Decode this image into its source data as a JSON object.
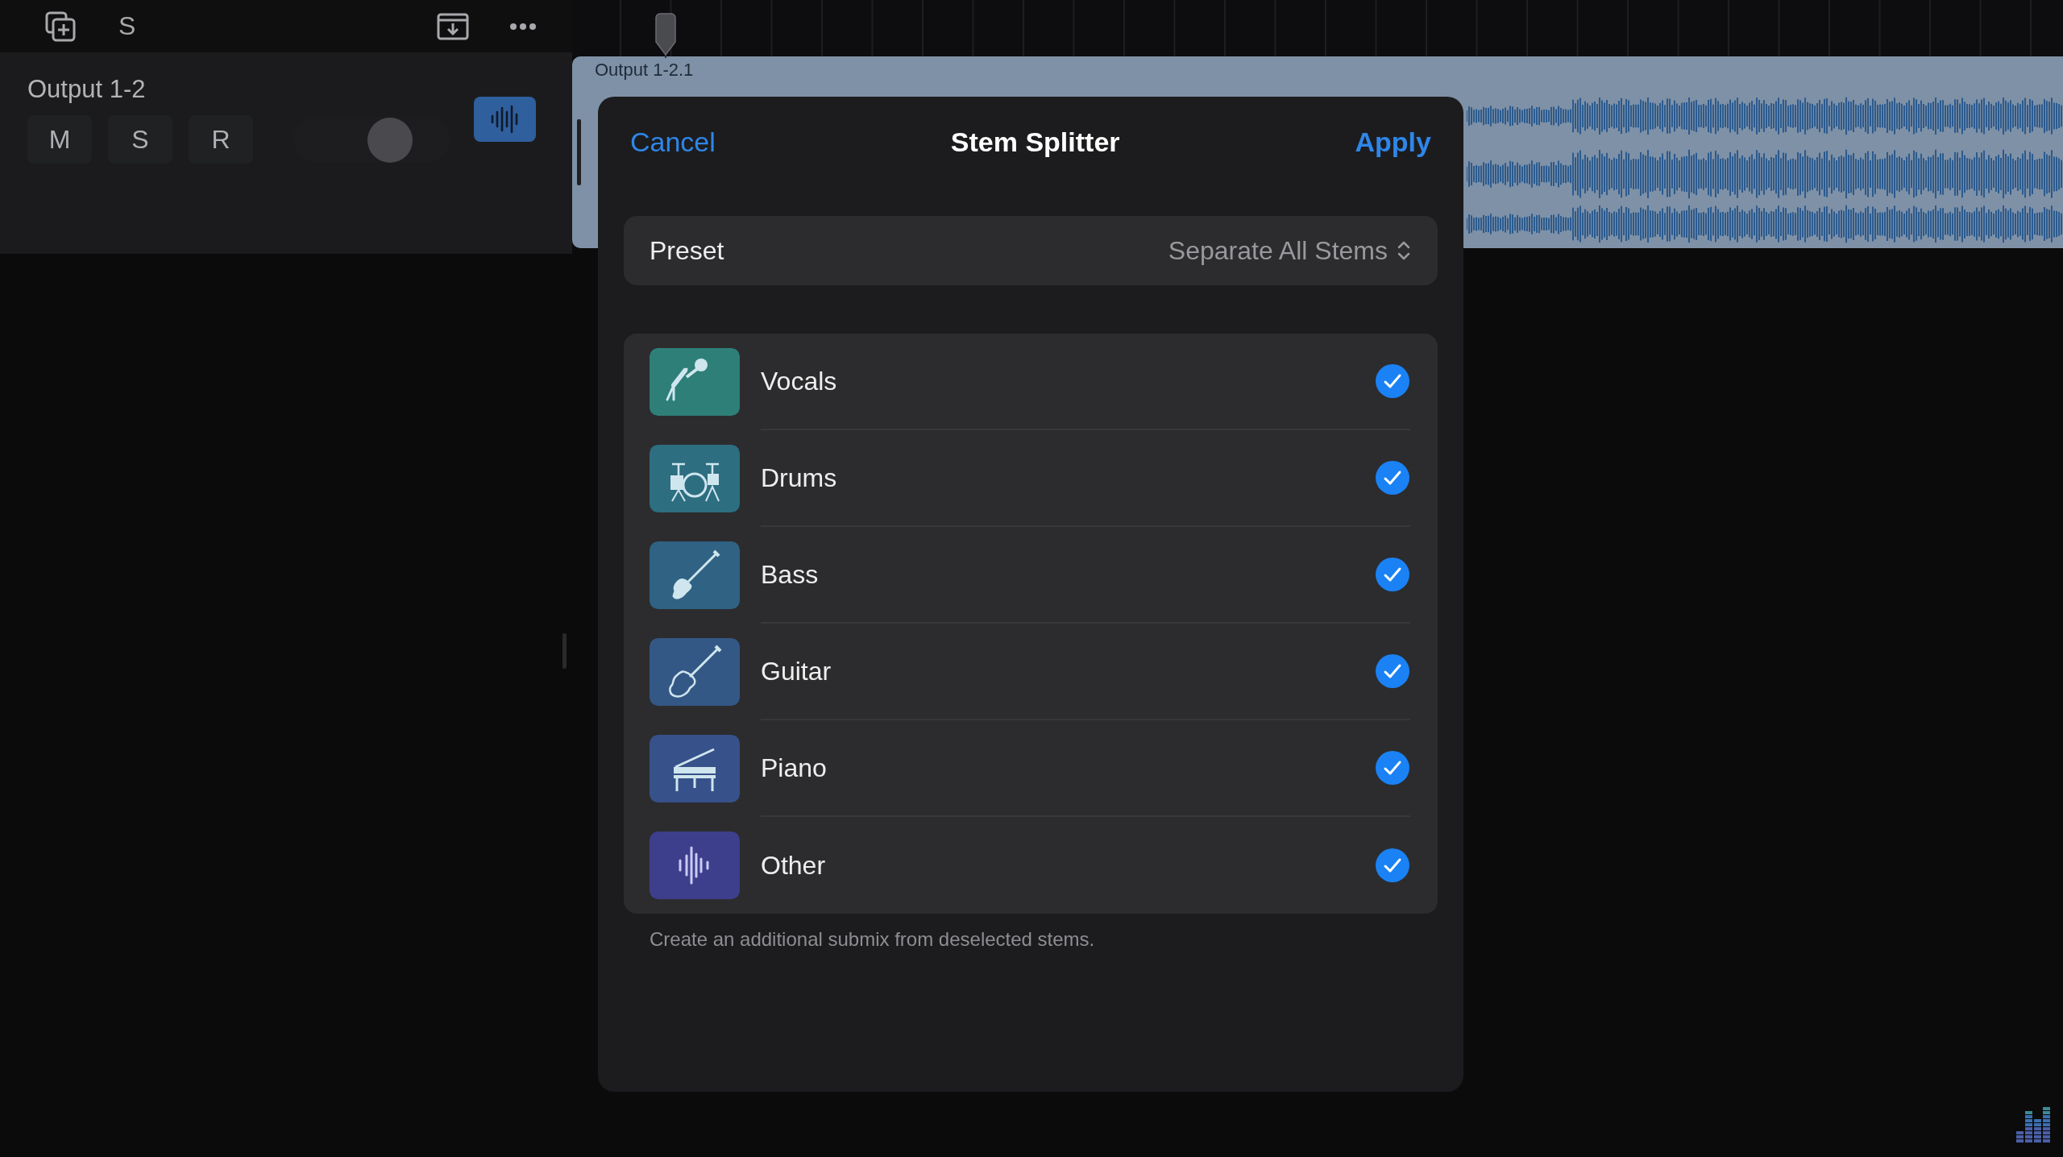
{
  "toolbar": {
    "label": "S"
  },
  "track": {
    "name": "Output 1-2",
    "buttons": [
      "M",
      "S",
      "R"
    ],
    "volume": {
      "level": 0.66
    }
  },
  "region": {
    "label": "Output 1-2.1"
  },
  "dialog": {
    "cancel": "Cancel",
    "title": "Stem Splitter",
    "apply": "Apply",
    "preset": {
      "label": "Preset",
      "value": "Separate All Stems"
    },
    "stems": [
      {
        "name": "Vocals",
        "kind": "microphone",
        "color": "#2e7f78",
        "checked": true
      },
      {
        "name": "Drums",
        "kind": "drums",
        "color": "#2d6e80",
        "checked": true
      },
      {
        "name": "Bass",
        "kind": "bass",
        "color": "#2f6283",
        "checked": true
      },
      {
        "name": "Guitar",
        "kind": "guitar",
        "color": "#345886",
        "checked": true
      },
      {
        "name": "Piano",
        "kind": "piano",
        "color": "#37518a",
        "checked": true
      },
      {
        "name": "Other",
        "kind": "wave",
        "color": "#3d3f8c",
        "checked": true
      }
    ],
    "note": "Create an additional submix from deselected stems."
  }
}
